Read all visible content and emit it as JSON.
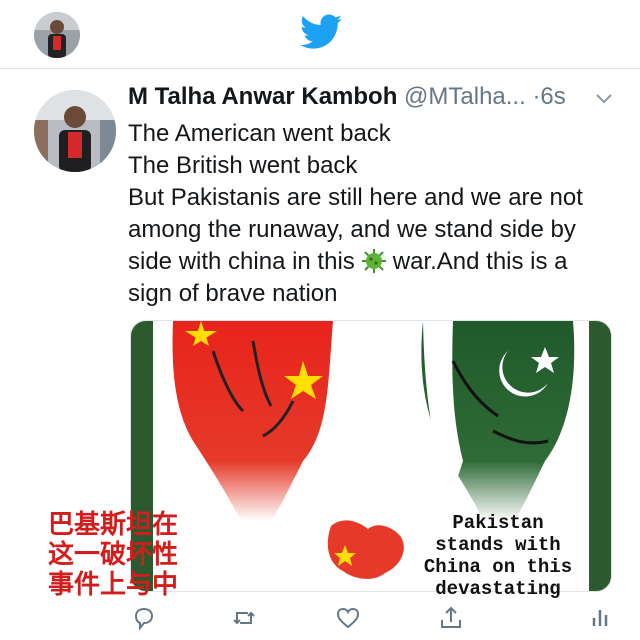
{
  "tweet": {
    "name": "M Talha Anwar Kamboh",
    "handle": "@MTalha...",
    "time": "·6s",
    "lines": [
      "The American went back",
      "The British went back",
      "But Pakistanis are still here and we are not among the runaway, and we stand side by side with china in this",
      "war.And this is a sign of brave nation"
    ]
  },
  "media": {
    "cn_text": "巴基斯坦在\n这一破坏性\n事件上与中",
    "pk_text": "Pakistan\nstands with\nChina on this\ndevastating"
  },
  "icons": [
    "twitter-bird-icon",
    "chevron-down-icon",
    "virus-icon",
    "reply-icon",
    "retweet-icon",
    "like-icon",
    "share-icon",
    "analytics-icon"
  ],
  "colors": {
    "twitter_blue": "#1da1f2",
    "icon_gray": "#657786",
    "china_red": "#de2910",
    "pakistan_green": "#01411c"
  }
}
